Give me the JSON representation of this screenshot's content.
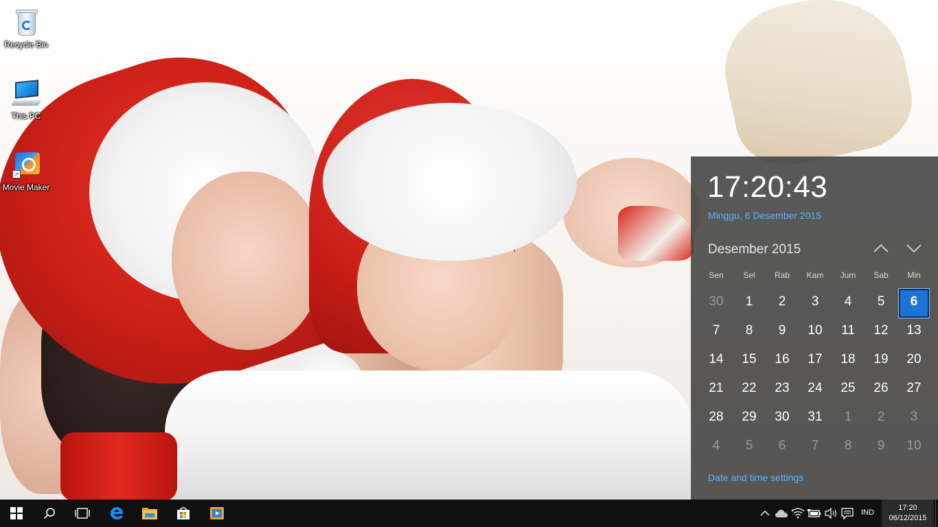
{
  "desktop": {
    "icons": [
      {
        "label": "Recycle Bin",
        "icon": "recycle-bin-icon"
      },
      {
        "label": "This PC",
        "icon": "computer-icon"
      },
      {
        "label": "Movie Maker",
        "icon": "movie-maker-icon"
      }
    ]
  },
  "calendar_flyout": {
    "time": "17:20:43",
    "date_long": "Minggu, 6 Desember 2015",
    "month_title": "Desember 2015",
    "weekdays": [
      "Sen",
      "Sel",
      "Rab",
      "Kam",
      "Jum",
      "Sab",
      "Min"
    ],
    "days": [
      {
        "n": "30",
        "other": true
      },
      {
        "n": "1"
      },
      {
        "n": "2"
      },
      {
        "n": "3"
      },
      {
        "n": "4"
      },
      {
        "n": "5"
      },
      {
        "n": "6",
        "today": true
      },
      {
        "n": "7"
      },
      {
        "n": "8"
      },
      {
        "n": "9"
      },
      {
        "n": "10"
      },
      {
        "n": "11"
      },
      {
        "n": "12"
      },
      {
        "n": "13"
      },
      {
        "n": "14"
      },
      {
        "n": "15"
      },
      {
        "n": "16"
      },
      {
        "n": "17"
      },
      {
        "n": "18"
      },
      {
        "n": "19"
      },
      {
        "n": "20"
      },
      {
        "n": "21"
      },
      {
        "n": "22"
      },
      {
        "n": "23"
      },
      {
        "n": "24"
      },
      {
        "n": "25"
      },
      {
        "n": "26"
      },
      {
        "n": "27"
      },
      {
        "n": "28"
      },
      {
        "n": "29"
      },
      {
        "n": "30"
      },
      {
        "n": "31"
      },
      {
        "n": "1",
        "other": true
      },
      {
        "n": "2",
        "other": true
      },
      {
        "n": "3",
        "other": true
      },
      {
        "n": "4",
        "other": true
      },
      {
        "n": "5",
        "other": true
      },
      {
        "n": "6",
        "other": true
      },
      {
        "n": "7",
        "other": true
      },
      {
        "n": "8",
        "other": true
      },
      {
        "n": "9",
        "other": true
      },
      {
        "n": "10",
        "other": true
      }
    ],
    "settings_link": "Date and time settings"
  },
  "taskbar": {
    "buttons": [
      "start-icon",
      "search-icon",
      "task-view-icon",
      "edge-icon",
      "file-explorer-icon",
      "store-icon",
      "movie-maker-icon"
    ],
    "tray_icons": [
      "chevron-up-icon",
      "onedrive-icon",
      "wifi-icon",
      "battery-icon",
      "volume-icon",
      "action-center-icon"
    ],
    "language": "IND",
    "clock_time": "17:20",
    "clock_date": "06/12/2015"
  },
  "colors": {
    "accent": "#1d72d6",
    "link": "#5cb1ff",
    "flyout_bg": "#3e3e3e",
    "taskbar_bg": "#101010"
  }
}
